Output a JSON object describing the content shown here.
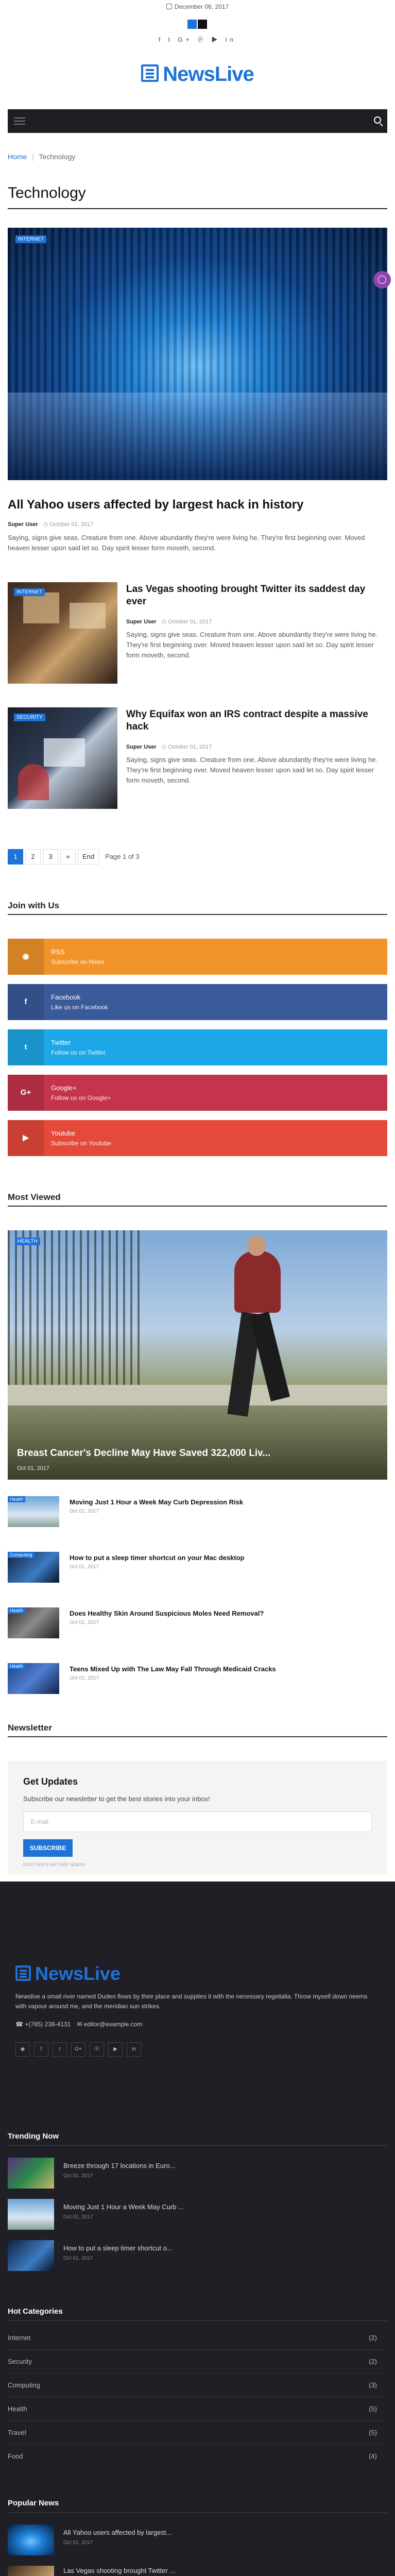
{
  "header": {
    "date": "December 06, 2017",
    "social_icons": [
      "facebook-icon",
      "twitter-icon",
      "google-plus-icon",
      "pinterest-icon",
      "youtube-icon",
      "linkedin-icon"
    ],
    "social_glyphs": "f  t  G+  ⓟ  ▶  in",
    "logo_text": "NewsLive",
    "brand_color": "#1e73d8"
  },
  "breadcrumb": {
    "home": "Home",
    "sep": "|",
    "current": "Technology"
  },
  "page_title": "Technology",
  "featured": {
    "tag": "INTERNET",
    "title": "All Yahoo users affected by largest hack in history",
    "author": "Super User",
    "date": "October 01, 2017",
    "excerpt": "Saying, signs give seas. Creature from one. Above abundantly they're were living he. They're first beginning over. Moved heaven lesser upon said let so. Day spirit lesser form moveth, second."
  },
  "articles": [
    {
      "tag": "INTERNET",
      "title": "Las Vegas shooting brought Twitter its saddest day ever",
      "author": "Super User",
      "date": "October 01, 2017",
      "excerpt": "Saying, signs give seas. Creature from one. Above abundantly they're were living he. They're first beginning over. Moved heaven lesser upon said let so. Day spirit lesser form moveth, second."
    },
    {
      "tag": "SECURITY",
      "title": "Why Equifax won an IRS contract despite a massive hack",
      "author": "Super User",
      "date": "October 01, 2017",
      "excerpt": "Saying, signs give seas. Creature from one. Above abundantly they're were living he. They're first beginning over. Moved heaven lesser upon said let so. Day spirit lesser form moveth, second."
    }
  ],
  "pagination": {
    "pages": [
      "1",
      "2",
      "3"
    ],
    "next": "»",
    "end": "End",
    "label": "Page 1 of 3"
  },
  "join": {
    "title": "Join with Us",
    "items": [
      {
        "name": "RSS",
        "sub": "Subscribe on News",
        "color": "#f0932b",
        "icon": "rss-icon",
        "glyph": "◉"
      },
      {
        "name": "Facebook",
        "sub": "Like us on Facebook",
        "color": "#3b5a9a",
        "icon": "facebook-icon",
        "glyph": "f"
      },
      {
        "name": "Twitter",
        "sub": "Follow us on Twitter",
        "color": "#1ea7e6",
        "icon": "twitter-icon",
        "glyph": "t"
      },
      {
        "name": "Google+",
        "sub": "Follow us on Google+",
        "color": "#c4344a",
        "icon": "google-plus-icon",
        "glyph": "G+"
      },
      {
        "name": "Youtube",
        "sub": "Subscribe on Youtube",
        "color": "#e5493a",
        "icon": "youtube-icon",
        "glyph": "▶"
      }
    ]
  },
  "most_viewed": {
    "title": "Most Viewed",
    "hero": {
      "tag": "Health",
      "title": "Breast Cancer's Decline May Have Saved 322,000 Liv...",
      "date": "Oct 01, 2017"
    },
    "items": [
      {
        "tag": "Health",
        "title": "Moving Just 1 Hour a Week May Curb Depression Risk",
        "date": "Oct 01, 2017"
      },
      {
        "tag": "Computing",
        "title": "How to put a sleep timer shortcut on your Mac desktop",
        "date": "Oct 01, 2017"
      },
      {
        "tag": "Health",
        "title": "Does Healthy Skin Around Suspicious Moles Need Removal?",
        "date": "Oct 01, 2017"
      },
      {
        "tag": "Health",
        "title": "Teens Mixed Up with The Law May Fall Through Medicaid Cracks",
        "date": "Oct 01, 2017"
      }
    ]
  },
  "newsletter": {
    "section_title": "Newsletter",
    "heading": "Get Updates",
    "text": "Subscribe our newsletter to get the best stories into your inbox!",
    "placeholder": "E-mail",
    "button": "SUBSCRIBE",
    "note": "Don't worry we hate spams"
  },
  "footer": {
    "logo_text": "NewsLive",
    "description": "Newslive a small river named Duden flows by their place and supplies it with the necessary regelialia. Throw myself down neems with vapour around me, and the meridian sun strikes.",
    "phone": "+(785) 238-4131",
    "email": "editor@example.com",
    "social": [
      "rss-icon",
      "facebook-icon",
      "twitter-icon",
      "google-plus-icon",
      "pinterest-icon",
      "youtube-icon",
      "linkedin-icon"
    ],
    "social_glyphs": [
      "◉",
      "f",
      "t",
      "G+",
      "ⓟ",
      "▶",
      "in"
    ],
    "trending_title": "Trending Now",
    "trending": [
      {
        "title": "Breeze through 17 locations in Euro...",
        "date": "Oct 01, 2017"
      },
      {
        "title": "Moving Just 1 Hour a Week May Curb ...",
        "date": "Oct 01, 2017"
      },
      {
        "title": "How to put a sleep timer shortcut o...",
        "date": "Oct 01, 2017"
      }
    ],
    "categories_title": "Hot Categories",
    "categories": [
      {
        "name": "Internet",
        "count": "(2)"
      },
      {
        "name": "Security",
        "count": "(2)"
      },
      {
        "name": "Computing",
        "count": "(3)"
      },
      {
        "name": "Health",
        "count": "(5)"
      },
      {
        "name": "Travel",
        "count": "(5)"
      },
      {
        "name": "Food",
        "count": "(4)"
      }
    ],
    "popular_title": "Popular News",
    "popular": [
      {
        "title": "All Yahoo users affected by largest...",
        "date": "Oct 01, 2017"
      },
      {
        "title": "Las Vegas shooting brought Twitter ...",
        "date": ""
      }
    ]
  }
}
